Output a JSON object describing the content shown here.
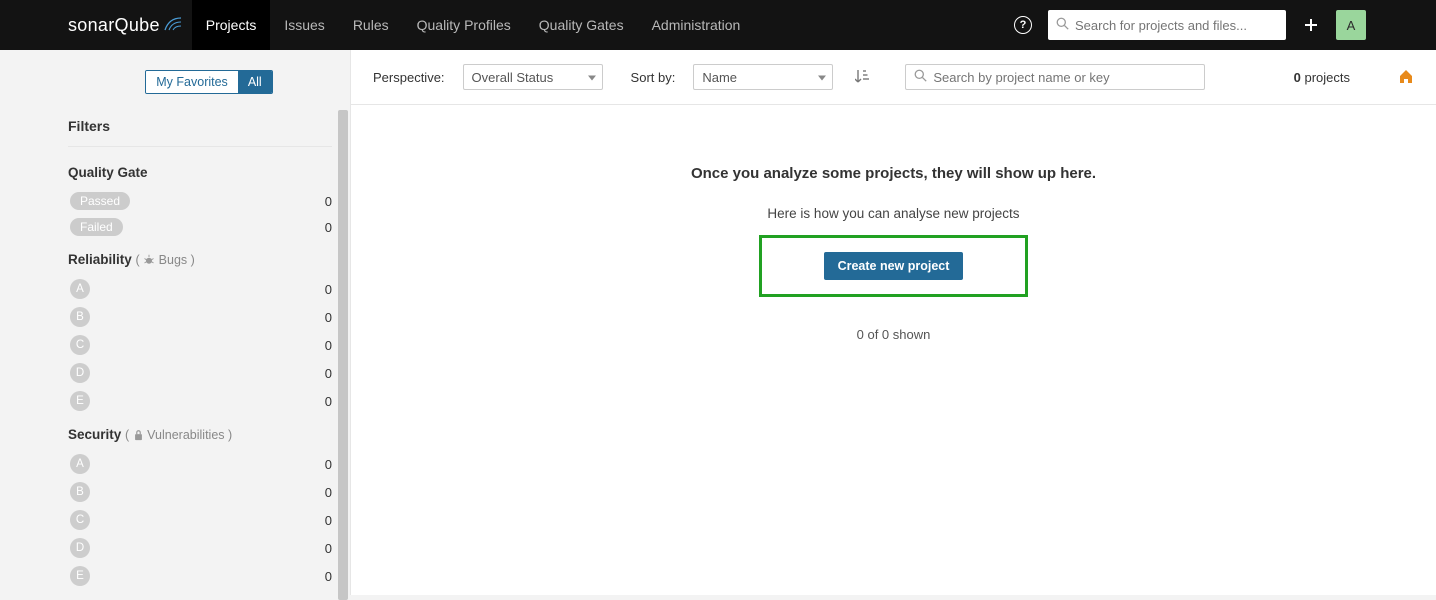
{
  "brand": {
    "name_a": "sonar",
    "name_b": "Qube"
  },
  "nav": {
    "items": [
      "Projects",
      "Issues",
      "Rules",
      "Quality Profiles",
      "Quality Gates",
      "Administration"
    ],
    "active_index": 0
  },
  "global_search": {
    "placeholder": "Search for projects and files..."
  },
  "avatar": {
    "initial": "A"
  },
  "sidebar": {
    "toggle": {
      "favorites": "My Favorites",
      "all": "All",
      "active": "all"
    },
    "filters_header": "Filters",
    "quality_gate": {
      "title": "Quality Gate",
      "passed": {
        "label": "Passed",
        "count": 0
      },
      "failed": {
        "label": "Failed",
        "count": 0
      }
    },
    "reliability": {
      "title": "Reliability",
      "sub": "Bugs",
      "grades": [
        {
          "letter": "A",
          "count": 0
        },
        {
          "letter": "B",
          "count": 0
        },
        {
          "letter": "C",
          "count": 0
        },
        {
          "letter": "D",
          "count": 0
        },
        {
          "letter": "E",
          "count": 0
        }
      ]
    },
    "security": {
      "title": "Security",
      "sub": "Vulnerabilities",
      "grades": [
        {
          "letter": "A",
          "count": 0
        },
        {
          "letter": "B",
          "count": 0
        },
        {
          "letter": "C",
          "count": 0
        },
        {
          "letter": "D",
          "count": 0
        },
        {
          "letter": "E",
          "count": 0
        }
      ]
    }
  },
  "toolbar": {
    "perspective_label": "Perspective:",
    "perspective_value": "Overall Status",
    "sort_label": "Sort by:",
    "sort_value": "Name",
    "search_placeholder": "Search by project name or key",
    "count_num": "0",
    "count_label": " projects"
  },
  "empty": {
    "heading": "Once you analyze some projects, they will show up here.",
    "subtext": "Here is how you can analyse new projects",
    "cta": "Create new project",
    "shown": "0 of 0 shown"
  }
}
